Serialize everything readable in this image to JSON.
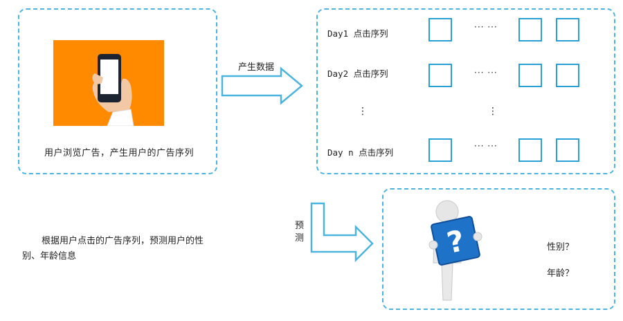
{
  "user_panel": {
    "caption": "用户浏览广告，产生用户的广告序列"
  },
  "arrows": {
    "generate_label": "产生数据",
    "predict_label": "预测"
  },
  "days_panel": {
    "rows": [
      {
        "label": "Day1 点击序列"
      },
      {
        "label": "Day2 点击序列"
      },
      {
        "label": "Day n 点击序列"
      }
    ],
    "ellipsis": "··· ···",
    "vertical_ellipsis": "⋮"
  },
  "description": "根据用户点击的广告序列，预测用户的性别、年龄信息",
  "predict_panel": {
    "questions": [
      "性别？",
      "年龄？"
    ]
  },
  "colors": {
    "accent": "#4cb3dc",
    "cell_border": "#2a9fd6",
    "photo_bg": "#ff8a00",
    "sign_blue": "#1e73c8"
  }
}
